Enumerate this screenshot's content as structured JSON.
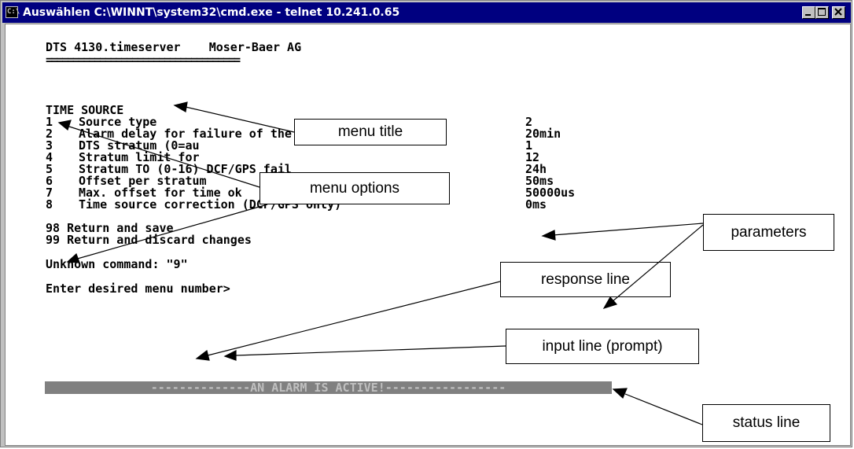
{
  "window": {
    "title": "Auswählen C:\\WINNT\\system32\\cmd.exe - telnet 10.241.0.65",
    "icon": "cmd-icon",
    "buttons": {
      "minimize": "minimize-icon",
      "maximize": "maximize-icon",
      "close": "close-icon"
    }
  },
  "terminal": {
    "header": "DTS 4130.timeserver    Moser-Baer AG",
    "separator": "====================================",
    "menu_title": "TIME SOURCE",
    "options": [
      {
        "num": "1",
        "label": "Source type",
        "value": "2"
      },
      {
        "num": "2",
        "label": "Alarm delay for failure of the source",
        "value": "20min"
      },
      {
        "num": "3",
        "label": "DTS stratum (0=au",
        "value": "1"
      },
      {
        "num": "4",
        "label": "Stratum limit for",
        "value": "12"
      },
      {
        "num": "5",
        "label": "Stratum TO (0-16) DCF/GPS fail",
        "value": "24h"
      },
      {
        "num": "6",
        "label": "Offset per stratum",
        "value": "50ms"
      },
      {
        "num": "7",
        "label": "Max. offset for time ok",
        "value": "50000us"
      },
      {
        "num": "8",
        "label": "Time source correction (DCF/GPS only)",
        "value": "0ms"
      }
    ],
    "return_save": "98 Return and save",
    "return_discard": "99 Return and discard changes",
    "response": "Unknown command: \"9\"",
    "prompt": "Enter desired menu number>",
    "status": "--------------AN ALARM IS ACTIVE!-----------------"
  },
  "callouts": {
    "menu_title": "menu title",
    "menu_options": "menu options",
    "parameters": "parameters",
    "response_line": "response line",
    "input_line": "input line (prompt)",
    "status_line": "status line"
  },
  "colors": {
    "titlebar": "#000080",
    "window_chrome": "#c0c0c0",
    "console_bg": "#ffffff",
    "console_text": "#000000",
    "status_bar": "#808080"
  }
}
